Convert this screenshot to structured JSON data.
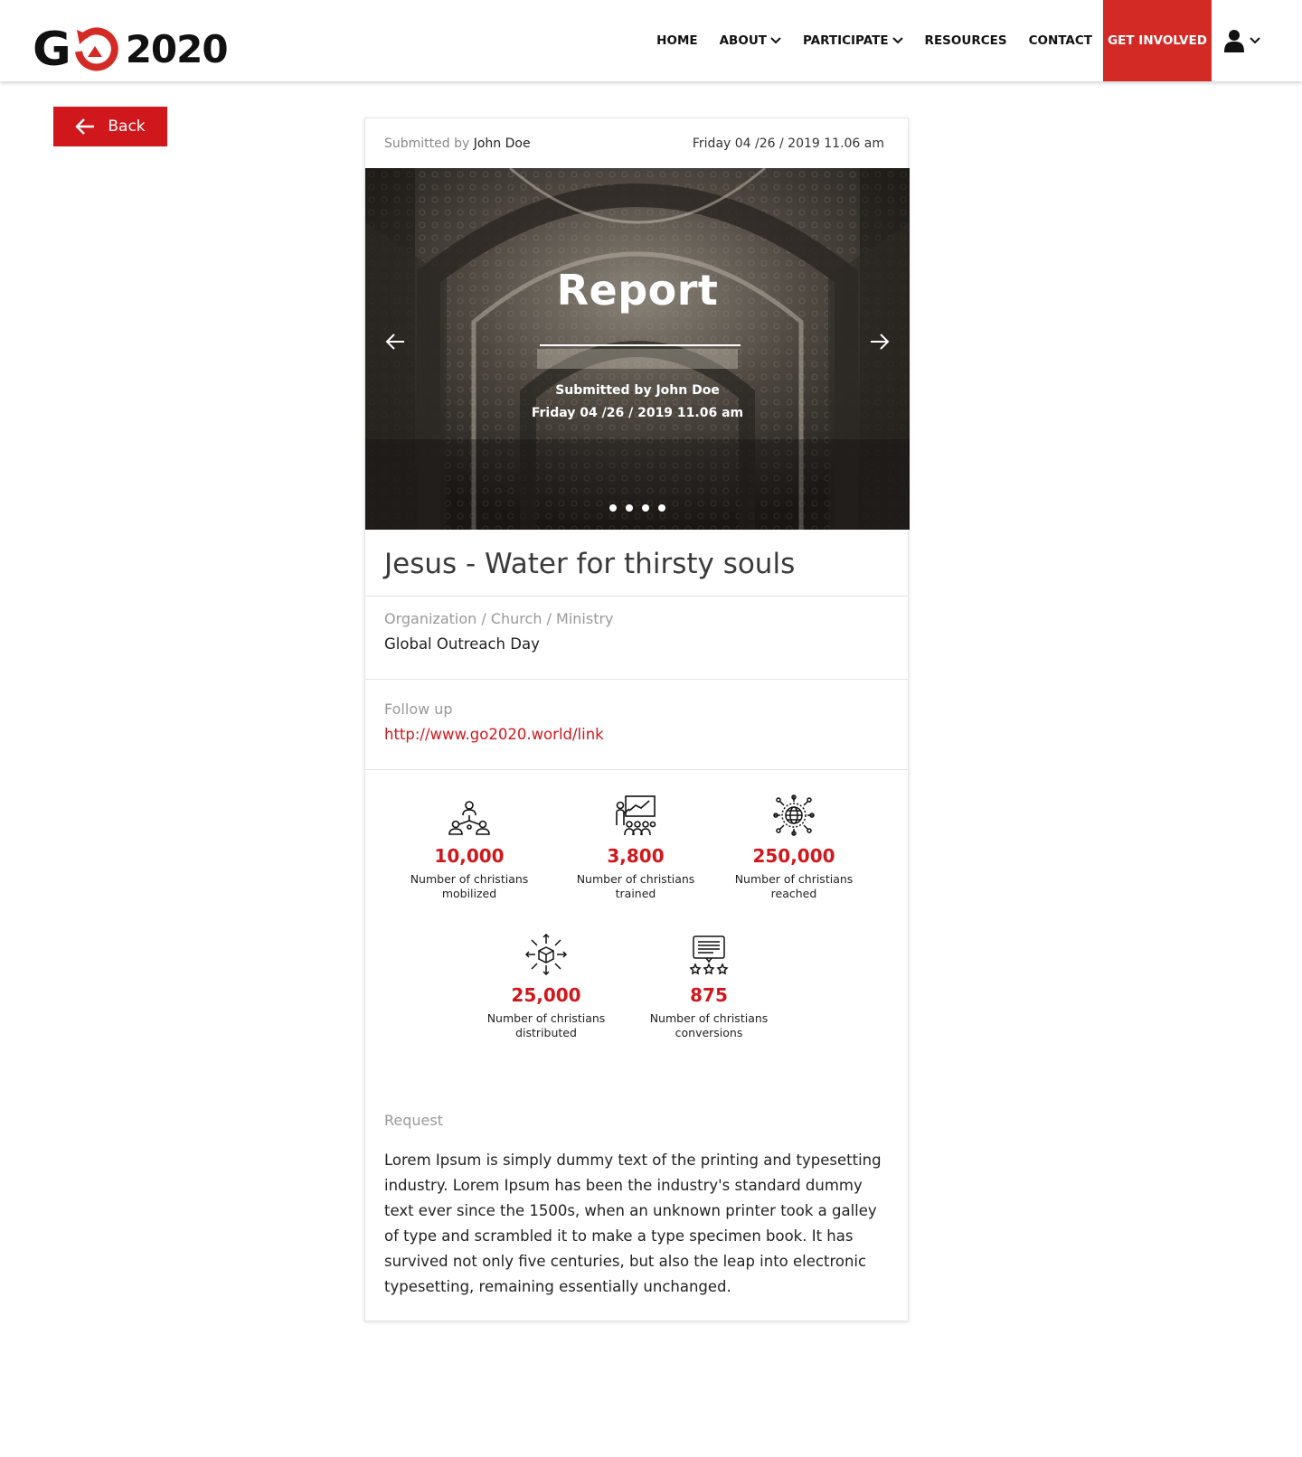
{
  "header": {
    "logo_left": "G",
    "logo_year": "2020",
    "nav": [
      {
        "label": "HOME",
        "dropdown": false
      },
      {
        "label": "ABOUT",
        "dropdown": true
      },
      {
        "label": "PARTICIPATE",
        "dropdown": true
      },
      {
        "label": "RESOURCES",
        "dropdown": false
      },
      {
        "label": "CONTACT",
        "dropdown": false
      }
    ],
    "cta": "GET INVOLVED",
    "user_icon": "user-icon",
    "accent": "#d42a26"
  },
  "back_label": "Back",
  "card": {
    "submitted_prefix": "Submitted by",
    "submitter": "John Doe",
    "date": "Friday 04 /26 / 2019 11.06 am",
    "hero": {
      "title": "Report",
      "sub1": "Submitted by John Doe",
      "sub2": "Friday 04 /26 / 2019 11.06 am",
      "slide_count": 4
    },
    "title": "Jesus - Water for thirsty souls",
    "org_label": "Organization / Church / Ministry",
    "org_value": "Global Outreach Day",
    "followup_label": "Follow up",
    "followup_link": "http://www.go2020.world/link",
    "stats": [
      {
        "icon": "people-network-icon",
        "value": "10,000",
        "line1": "Number of christians",
        "line2": "mobilized"
      },
      {
        "icon": "presentation-icon",
        "value": "3,800",
        "line1": "Number of christians",
        "line2": "trained"
      },
      {
        "icon": "globe-network-icon",
        "value": "250,000",
        "line1": "Number of christians",
        "line2": "reached"
      },
      {
        "icon": "box-distribution-icon",
        "value": "25,000",
        "line1": "Number of christians",
        "line2": "distributed"
      },
      {
        "icon": "review-stars-icon",
        "value": "875",
        "line1": "Number of christians",
        "line2": "conversions"
      }
    ],
    "request_label": "Request",
    "request_text": "Lorem Ipsum is simply dummy text of the printing and typesetting industry. Lorem Ipsum has been the industry's standard dummy text ever since the 1500s, when an unknown printer took a galley of type and scrambled it to make a type specimen book. It has survived not only five centuries, but also the leap into electronic typesetting, remaining essentially unchanged."
  }
}
